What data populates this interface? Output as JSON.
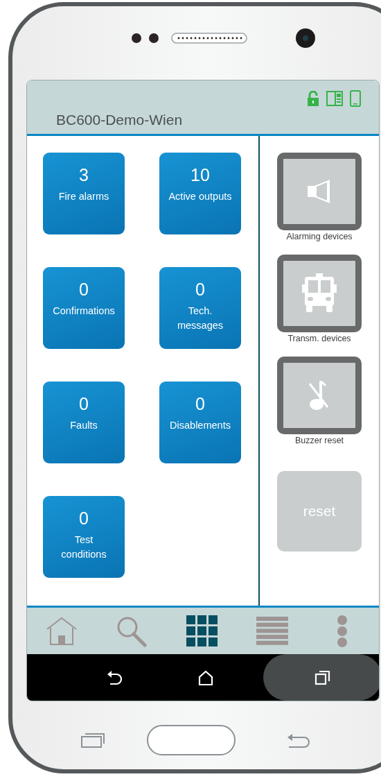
{
  "header": {
    "title": "BC600-Demo-Wien"
  },
  "tiles": [
    {
      "count": "3",
      "label_lines": [
        "Fire alarms"
      ]
    },
    {
      "count": "10",
      "label_lines": [
        "Active outputs"
      ]
    },
    {
      "count": "0",
      "label_lines": [
        "Confirmations"
      ]
    },
    {
      "count": "0",
      "label_lines": [
        "Tech.",
        "messages"
      ]
    },
    {
      "count": "0",
      "label_lines": [
        "Faults"
      ]
    },
    {
      "count": "0",
      "label_lines": [
        "Disablements"
      ]
    },
    {
      "count": "0",
      "label_lines": [
        "Test",
        "conditions"
      ]
    }
  ],
  "side_buttons": [
    {
      "kind": "speaker",
      "label": "Alarming devices"
    },
    {
      "kind": "bus",
      "label": "Transm. devices"
    },
    {
      "kind": "buzzer",
      "label": "Buzzer reset"
    },
    {
      "kind": "text",
      "label": "reset"
    }
  ],
  "bottom_nav": [
    {
      "kind": "home",
      "selected": false
    },
    {
      "kind": "search",
      "selected": false
    },
    {
      "kind": "grid",
      "selected": true
    },
    {
      "kind": "list",
      "selected": false
    },
    {
      "kind": "more",
      "selected": false
    }
  ],
  "system_nav": [
    {
      "kind": "back",
      "selected": false
    },
    {
      "kind": "home",
      "selected": false
    },
    {
      "kind": "recents",
      "selected": true
    }
  ]
}
